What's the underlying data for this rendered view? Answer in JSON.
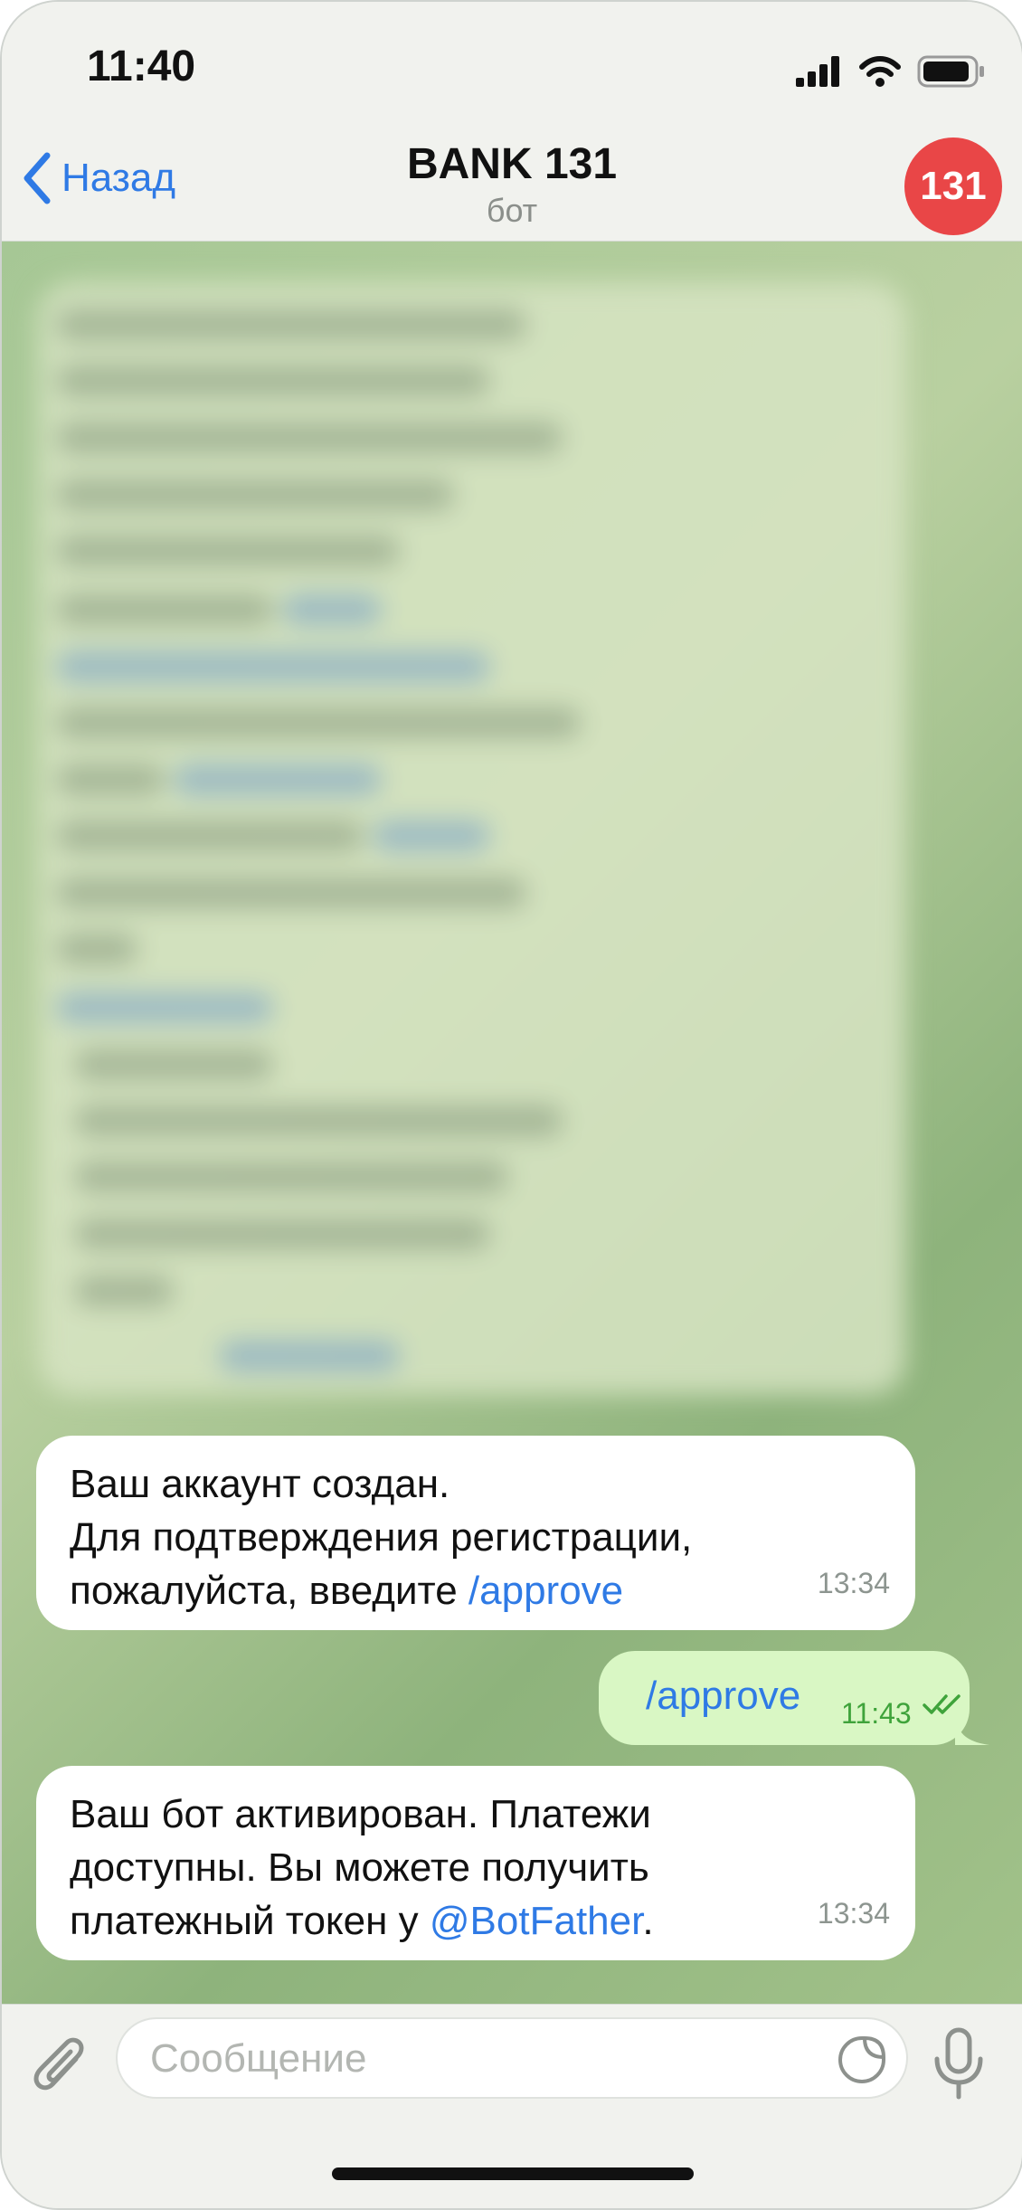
{
  "status_bar": {
    "time": "11:40",
    "icons": [
      "cellular-signal-icon",
      "wifi-icon",
      "battery-icon"
    ]
  },
  "header": {
    "back_label": "Назад",
    "title": "BANK 131",
    "subtitle": "бот",
    "avatar_text": "131",
    "avatar_color": "#e94647"
  },
  "messages": [
    {
      "direction": "incoming",
      "lines": [
        "Ваш аккаунт создан.",
        "Для подтверждения регистрации,",
        "пожалуйста, введите "
      ],
      "link": "/approve",
      "time": "13:34"
    },
    {
      "direction": "outgoing",
      "text": "/approve",
      "time": "11:43",
      "status": "read"
    },
    {
      "direction": "incoming",
      "lines": [
        "Ваш бот активирован. Платежи",
        "доступны. Вы можете получить",
        "платежный токен у "
      ],
      "link": "@BotFather",
      "suffix": ".",
      "time": "13:34"
    }
  ],
  "composer": {
    "placeholder": "Сообщение"
  },
  "colors": {
    "accent": "#2f7ae5",
    "outgoing_bubble": "#d9f7c4",
    "incoming_bubble": "#ffffff",
    "read_check": "#3fa33b"
  }
}
